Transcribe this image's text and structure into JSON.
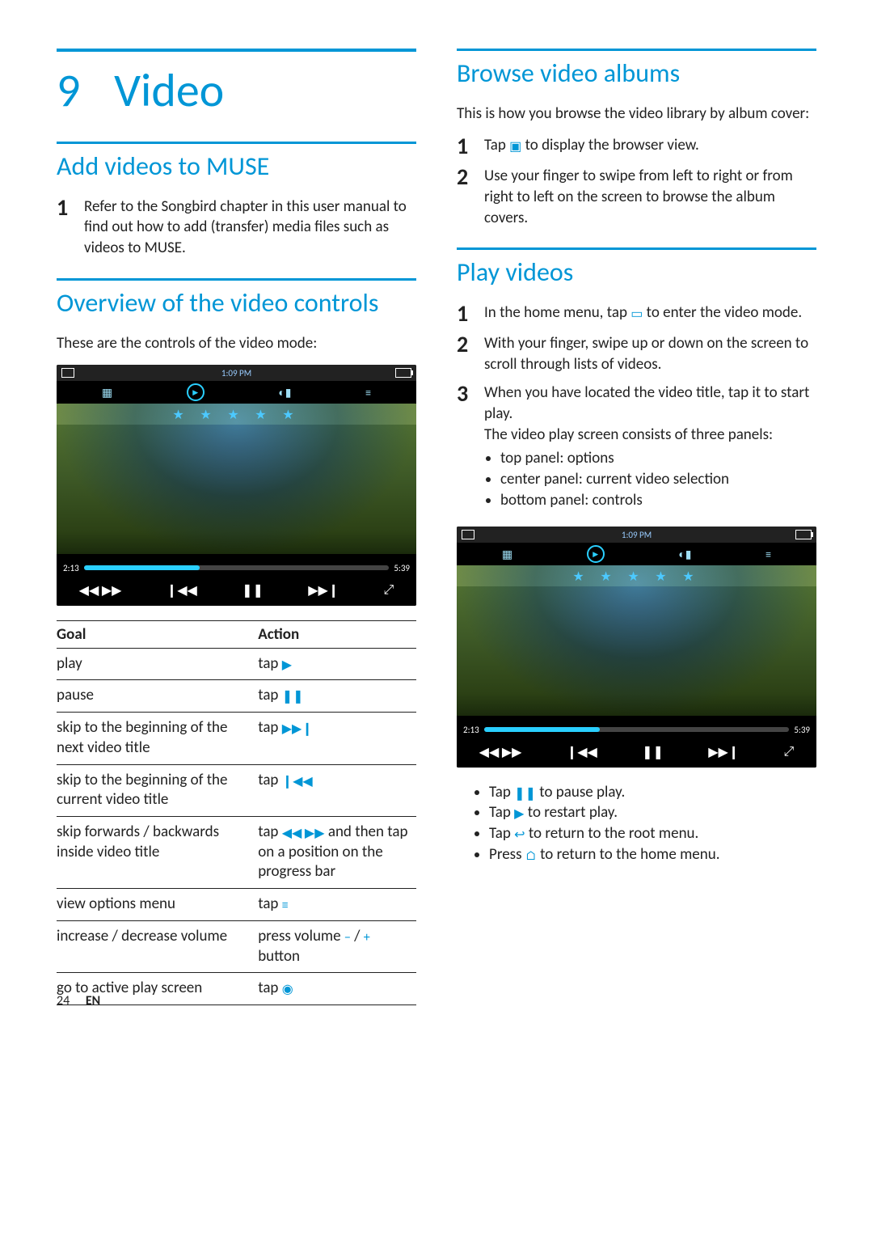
{
  "chapter": {
    "number": "9",
    "title": "Video"
  },
  "left": {
    "sec1": {
      "title": "Add videos to MUSE",
      "steps": [
        "Refer to the Songbird chapter in this user manual to find out how to add (transfer) media files such as videos to MUSE."
      ]
    },
    "sec2": {
      "title": "Overview of the video controls",
      "intro": "These are the controls of the video mode:"
    },
    "player": {
      "time": "1:09 PM",
      "cur": "2:13",
      "dur": "5:39"
    },
    "table": {
      "headers": {
        "goal": "Goal",
        "action": "Action"
      },
      "rows": [
        {
          "goal": "play",
          "action_pre": "tap ",
          "icon": "play",
          "action_post": ""
        },
        {
          "goal": "pause",
          "action_pre": "tap ",
          "icon": "pause",
          "action_post": ""
        },
        {
          "goal": "skip to the beginning of the next video title",
          "action_pre": "tap ",
          "icon": "next",
          "action_post": ""
        },
        {
          "goal": "skip to the beginning of the current video title",
          "action_pre": "tap ",
          "icon": "prev",
          "action_post": ""
        },
        {
          "goal": "skip forwards / backwards inside video title",
          "action_pre": "tap ",
          "icon": "seek",
          "action_post": " and then tap on a position on the progress bar"
        },
        {
          "goal": "view options menu",
          "action_pre": "tap ",
          "icon": "menu",
          "action_post": ""
        },
        {
          "goal": "increase / decrease volume",
          "action_pre": "press volume ",
          "icon": "minus",
          "action_post": " / ",
          "icon2": "plus",
          "action_post2": " button"
        },
        {
          "goal": "go to active play screen",
          "action_pre": "tap ",
          "icon": "nowplaying",
          "action_post": ""
        }
      ]
    }
  },
  "right": {
    "sec1": {
      "title": "Browse video albums",
      "intro": "This is how you browse the video library by album cover:",
      "steps": [
        {
          "pre": "Tap ",
          "icon": "browse",
          "post": " to display the browser view."
        },
        {
          "pre": "",
          "icon": "",
          "post": "Use your finger to swipe from left to right or from right to left on the screen to browse the album covers."
        }
      ]
    },
    "sec2": {
      "title": "Play videos",
      "steps": [
        {
          "pre": "In the home menu, tap ",
          "icon": "video",
          "post": " to enter the video mode."
        },
        {
          "pre": "",
          "icon": "",
          "post": "With your finger, swipe up or down on the screen to scroll through lists of videos."
        },
        {
          "pre": "",
          "icon": "",
          "post": "When you have located the video title, tap it to start play.",
          "extra": "The video play screen consists of three panels:",
          "panels": [
            "top panel: options",
            "center panel: current video selection",
            "bottom panel: controls"
          ]
        }
      ]
    },
    "player": {
      "time": "1:09 PM",
      "cur": "2:13",
      "dur": "5:39"
    },
    "after_bullets": [
      {
        "pre": "Tap ",
        "icon": "pause",
        "post": " to pause play."
      },
      {
        "pre": "Tap ",
        "icon": "play",
        "post": " to restart play."
      },
      {
        "pre": "Tap ",
        "icon": "back",
        "post": " to return to the root menu."
      },
      {
        "pre": "Press ",
        "icon": "home",
        "post": " to return to the home menu."
      }
    ]
  },
  "footer": {
    "page": "24",
    "lang": "EN"
  },
  "icons": {
    "play": "▶",
    "pause": "❚❚",
    "next": "▶▶❙",
    "prev": "❙◀◀",
    "seek": "◀◀ ▶▶",
    "menu": "≡",
    "minus": "−",
    "plus": "+",
    "nowplaying": "◉",
    "browse": "▣",
    "video": "▭",
    "back": "↩",
    "home": "⌂"
  }
}
